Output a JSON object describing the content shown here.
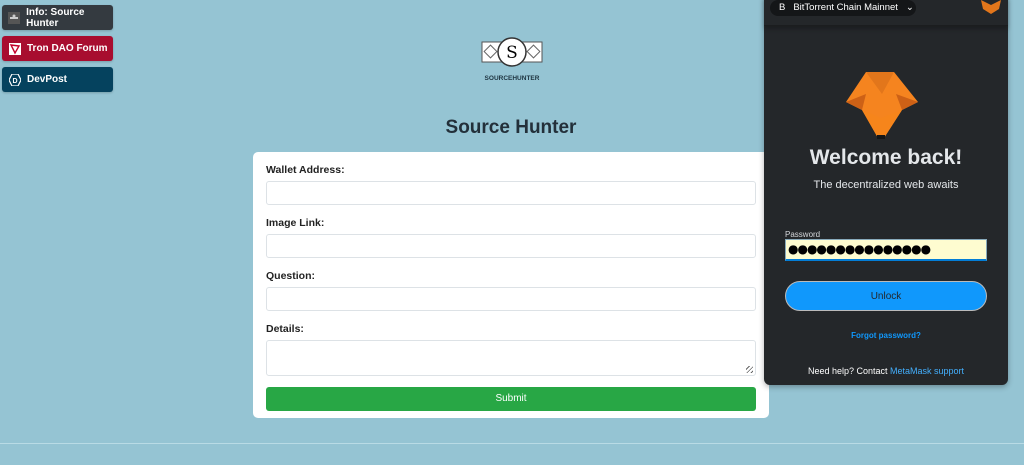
{
  "sidebar": {
    "items": [
      {
        "label": "Info: Source Hunter",
        "icon": "info-icon"
      },
      {
        "label": "Tron DAO Forum",
        "icon": "tron-icon"
      },
      {
        "label": "DevPost",
        "icon": "devpost-icon"
      }
    ]
  },
  "logo": {
    "letter": "S",
    "text": "SOURCEHUNTER"
  },
  "page": {
    "title": "Source Hunter"
  },
  "form": {
    "wallet_label": "Wallet Address:",
    "wallet_value": "",
    "image_label": "Image Link:",
    "image_value": "",
    "question_label": "Question:",
    "question_value": "",
    "details_label": "Details:",
    "details_value": "",
    "submit_label": "Submit"
  },
  "metamask": {
    "network": "BitTorrent Chain Mainnet",
    "network_icon": "B",
    "welcome": "Welcome back!",
    "subtitle": "The decentralized web awaits",
    "password_label": "Password",
    "password_mask": "●●●●●●●●●●●●●●●",
    "unlock_label": "Unlock",
    "forgot_label": "Forgot password?",
    "help_text": "Need help? Contact ",
    "help_link": "MetaMask support"
  },
  "colors": {
    "background": "#95c4d3",
    "submit": "#28a745",
    "unlock": "#1098fc",
    "tron": "#a80d2f",
    "devpost": "#05425e"
  }
}
